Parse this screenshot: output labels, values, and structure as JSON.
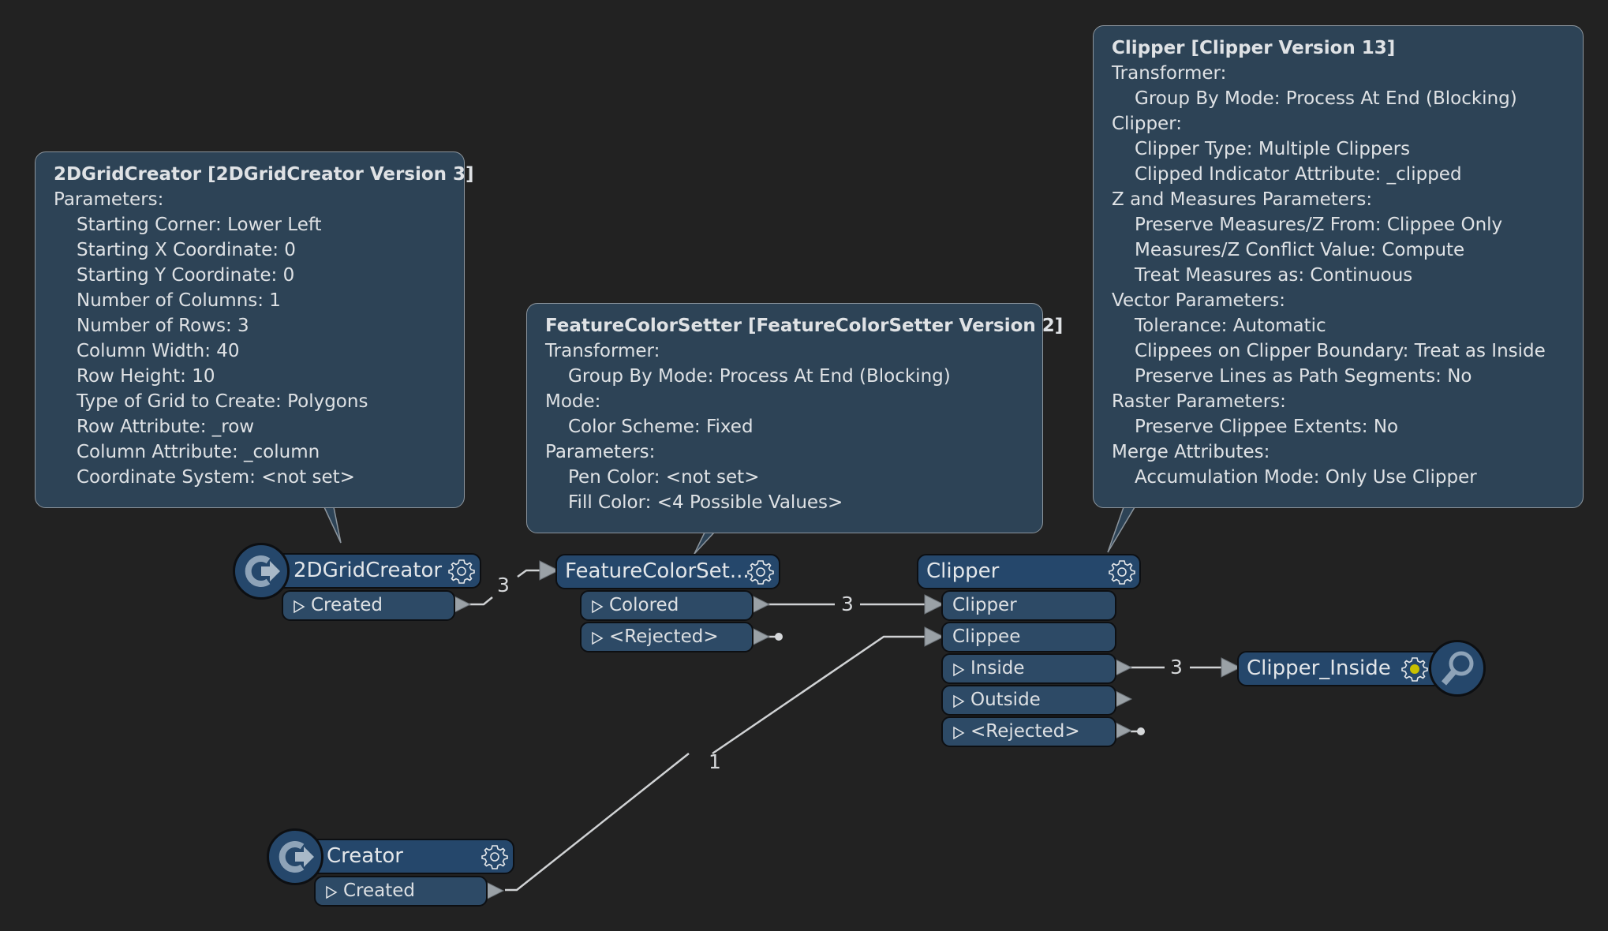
{
  "canvas": {
    "background": "#222222",
    "node_color": "#25476b",
    "port_color": "#2d4a66",
    "tooltip_color": "#2d4356",
    "wire_color": "#d0d2d4"
  },
  "tooltips": {
    "grid": {
      "title": "2DGridCreator [2DGridCreator Version 3]",
      "lines": [
        {
          "text": "Parameters:",
          "indent": false
        },
        {
          "text": "Starting Corner: Lower Left",
          "indent": true
        },
        {
          "text": "Starting X Coordinate: 0",
          "indent": true
        },
        {
          "text": "Starting Y Coordinate: 0",
          "indent": true
        },
        {
          "text": "Number of Columns: 1",
          "indent": true
        },
        {
          "text": "Number of Rows: 3",
          "indent": true
        },
        {
          "text": "Column Width: 40",
          "indent": true
        },
        {
          "text": "Row Height: 10",
          "indent": true
        },
        {
          "text": "Type of Grid to Create: Polygons",
          "indent": true
        },
        {
          "text": "Row Attribute: _row",
          "indent": true
        },
        {
          "text": "Column Attribute: _column",
          "indent": true
        },
        {
          "text": "Coordinate System: <not set>",
          "indent": true
        }
      ]
    },
    "fcs": {
      "title": "FeatureColorSetter [FeatureColorSetter Version 2]",
      "lines": [
        {
          "text": "Transformer:",
          "indent": false
        },
        {
          "text": "Group By Mode: Process At End (Blocking)",
          "indent": true
        },
        {
          "text": "Mode:",
          "indent": false
        },
        {
          "text": "Color Scheme: Fixed",
          "indent": true
        },
        {
          "text": "Parameters:",
          "indent": false
        },
        {
          "text": "Pen Color: <not set>",
          "indent": true
        },
        {
          "text": "Fill Color: <4 Possible Values>",
          "indent": true
        }
      ]
    },
    "clipper": {
      "title": "Clipper [Clipper Version 13]",
      "lines": [
        {
          "text": "Transformer:",
          "indent": false
        },
        {
          "text": "Group By Mode: Process At End (Blocking)",
          "indent": true
        },
        {
          "text": "Clipper:",
          "indent": false
        },
        {
          "text": "Clipper Type: Multiple Clippers",
          "indent": true
        },
        {
          "text": "Clipped Indicator Attribute: _clipped",
          "indent": true
        },
        {
          "text": "Z and Measures Parameters:",
          "indent": false
        },
        {
          "text": "Preserve Measures/Z From: Clippee Only",
          "indent": true
        },
        {
          "text": "Measures/Z Conflict Value: Compute",
          "indent": true
        },
        {
          "text": "Treat Measures as: Continuous",
          "indent": true
        },
        {
          "text": "Vector Parameters:",
          "indent": false
        },
        {
          "text": "Tolerance: Automatic",
          "indent": true
        },
        {
          "text": "Clippees on Clipper Boundary: Treat as Inside",
          "indent": true
        },
        {
          "text": "Preserve Lines as Path Segments: No",
          "indent": true
        },
        {
          "text": "Raster Parameters:",
          "indent": false
        },
        {
          "text": "Preserve Clippee Extents: No",
          "indent": true
        },
        {
          "text": "Merge Attributes:",
          "indent": false
        },
        {
          "text": "Accumulation Mode: Only Use Clipper",
          "indent": true
        }
      ]
    }
  },
  "nodes": {
    "grid": {
      "name": "2DGridCreator",
      "icon": "creator-icon",
      "outputs": [
        "Created"
      ]
    },
    "fcs": {
      "name": "FeatureColorSet...",
      "outputs": [
        "Colored",
        "<Rejected>"
      ]
    },
    "clipper": {
      "name": "Clipper",
      "inputs": [
        "Clipper",
        "Clippee"
      ],
      "outputs": [
        "Inside",
        "Outside",
        "<Rejected>"
      ]
    },
    "inspector": {
      "name": "Clipper_Inside",
      "icon": "inspector-magnifier-icon",
      "status_dot_color": "#c8c000"
    },
    "creator": {
      "name": "Creator",
      "icon": "creator-icon",
      "outputs": [
        "Created"
      ]
    }
  },
  "connections": [
    {
      "from": "2DGridCreator.Created",
      "to": "FeatureColorSetter",
      "count": "3"
    },
    {
      "from": "FeatureColorSetter.Colored",
      "to": "Clipper.Clipper",
      "count": "3"
    },
    {
      "from": "Clipper.Inside",
      "to": "Clipper_Inside",
      "count": "3"
    },
    {
      "from": "Creator.Created",
      "to": "Clipper.Clippee",
      "count": "1"
    }
  ]
}
